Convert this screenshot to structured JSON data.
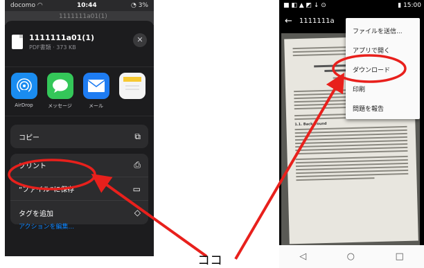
{
  "ios": {
    "status": {
      "carrier": "docomo",
      "time": "10:44",
      "battery": "3%"
    },
    "background_title": "1111111a01(1)",
    "file": {
      "name": "1111111a01(1)",
      "meta": "PDF書類 · 373 KB"
    },
    "apps": [
      {
        "label": "AirDrop",
        "color": "#1a8cf0"
      },
      {
        "label": "メッセージ",
        "color": "#34c759"
      },
      {
        "label": "メール",
        "color": "#1e7cf2"
      },
      {
        "label": "",
        "color": "#f4f4f4"
      }
    ],
    "actions_group1": [
      {
        "label": "コピー",
        "icon": "copy-icon"
      }
    ],
    "actions_group2": [
      {
        "label": "プリント",
        "icon": "printer-icon"
      },
      {
        "label": "“ファイル”に保存",
        "icon": "folder-icon"
      },
      {
        "label": "タグを追加",
        "icon": "tag-icon"
      }
    ],
    "edit_actions": "アクションを編集..."
  },
  "android": {
    "status": {
      "time": "15:00"
    },
    "appbar_title": "1111111a",
    "paper": {
      "section": "1.1. Background"
    },
    "menu": [
      {
        "label": "ファイルを送信..."
      },
      {
        "label": "アプリで開く"
      },
      {
        "label": "ダウンロード"
      },
      {
        "label": "印刷"
      },
      {
        "label": "問題を報告"
      }
    ]
  },
  "annotation": {
    "label": "ココ",
    "color": "#e8201c"
  }
}
